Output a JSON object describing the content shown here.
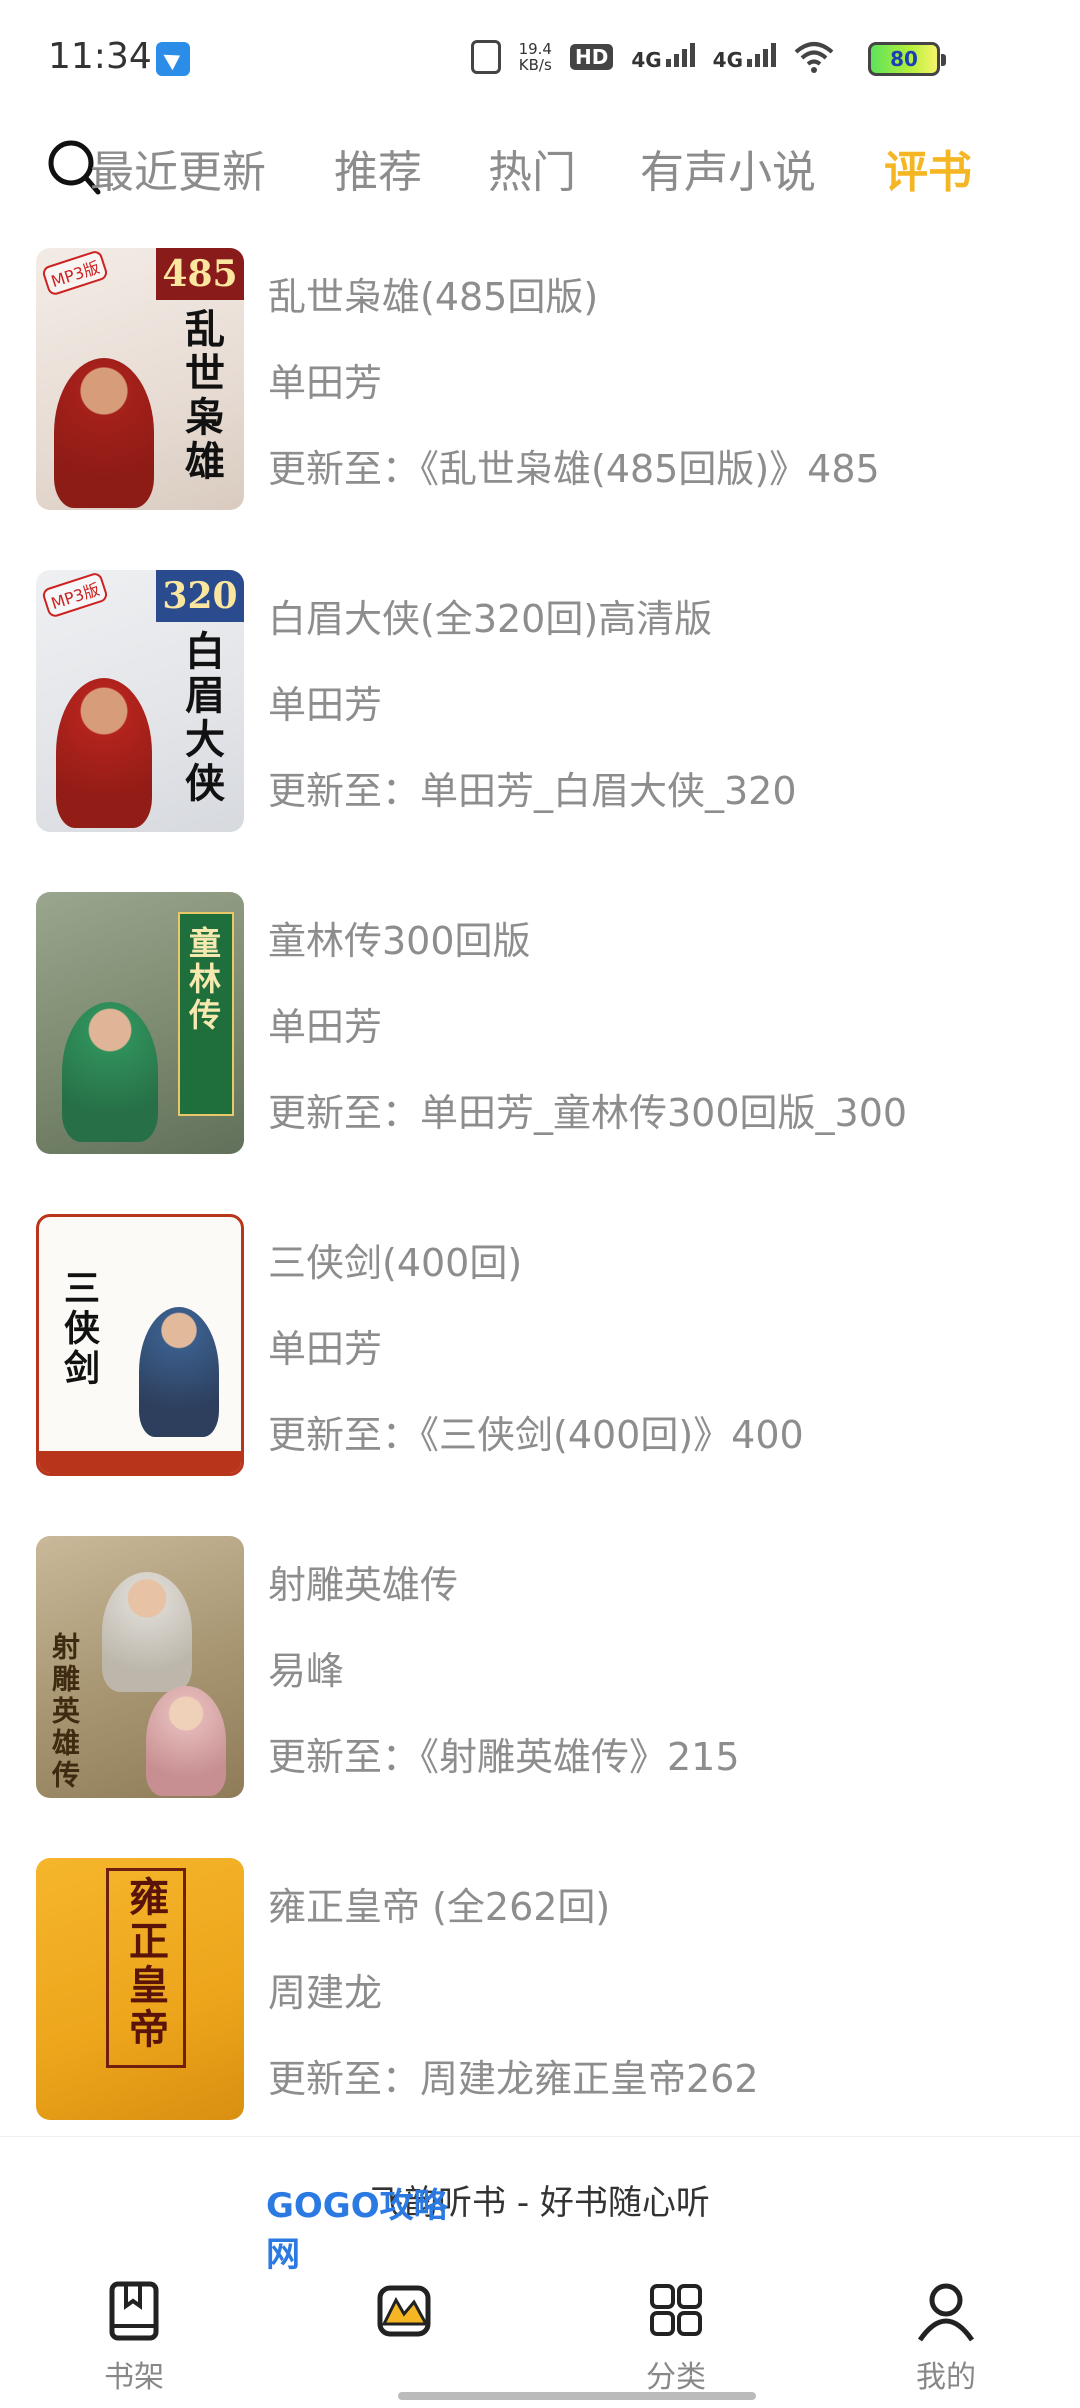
{
  "status_bar": {
    "time": "11:34",
    "net_speed_value": "19.4",
    "net_speed_unit": "KB/s",
    "hd": "HD",
    "sim1": "4G",
    "sim2": "4G",
    "battery": "80",
    "icons": [
      "app-notification-icon",
      "vibrate-icon",
      "wifi-icon",
      "battery-icon"
    ]
  },
  "tabs": {
    "items": [
      {
        "label": "最近更新"
      },
      {
        "label": "推荐"
      },
      {
        "label": "热门"
      },
      {
        "label": "有声小说"
      },
      {
        "label": "评书"
      }
    ],
    "active_index": 4,
    "active_color": "#f5b623"
  },
  "books": [
    {
      "title": "乱世枭雄(485回版)",
      "author": "单田芳",
      "update": "更新至：《乱世枭雄(485回版)》485",
      "cover_badge": "485",
      "cover_title": "乱世枭雄",
      "cover_tag": "MP3版"
    },
    {
      "title": "白眉大侠(全320回)高清版",
      "author": "单田芳",
      "update": "更新至：单田芳_白眉大侠_320",
      "cover_badge": "320",
      "cover_title": "白眉大侠",
      "cover_tag": "MP3版"
    },
    {
      "title": "童林传300回版",
      "author": "单田芳",
      "update": "更新至：单田芳_童林传300回版_300",
      "cover_title": "童林传"
    },
    {
      "title": "三侠剑(400回)",
      "author": "单田芳",
      "update": "更新至：《三侠剑(400回)》400",
      "cover_title": "三侠剑"
    },
    {
      "title": "射雕英雄传",
      "author": "易峰",
      "update": "更新至：《射雕英雄传》215",
      "cover_title": "射雕英雄传"
    },
    {
      "title": "雍正皇帝 (全262回)",
      "author": "周建龙",
      "update": "更新至：周建龙雍正皇帝262",
      "cover_title": "雍正皇帝"
    }
  ],
  "banner": {
    "text": "飞韵听书 - 好书随心听"
  },
  "bottom_nav": {
    "items": [
      {
        "label": "书架",
        "icon": "bookshelf-icon"
      },
      {
        "label": "",
        "icon": "discover-icon"
      },
      {
        "label": "分类",
        "icon": "category-grid-icon"
      },
      {
        "label": "我的",
        "icon": "profile-icon"
      }
    ]
  },
  "watermark": {
    "text": "GOGO攻略网"
  }
}
